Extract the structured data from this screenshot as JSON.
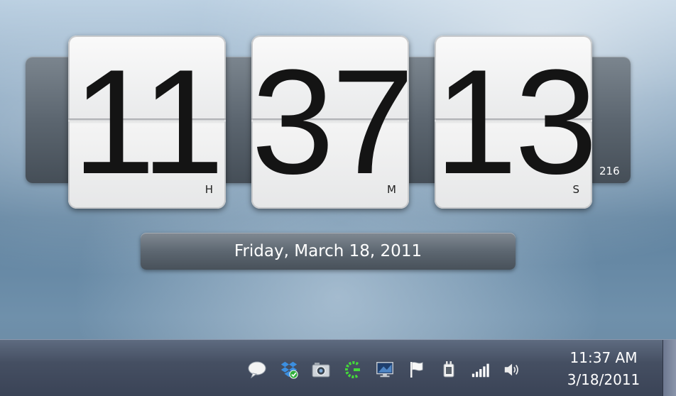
{
  "flip_clock": {
    "hours": "11",
    "minutes": "37",
    "seconds": "13",
    "hours_unit": "H",
    "minutes_unit": "M",
    "seconds_unit": "S",
    "milliseconds": "216",
    "date": "Friday, March 18, 2011"
  },
  "taskbar": {
    "tray_icons": [
      "chat-bubble-icon",
      "dropbox-icon",
      "camera-icon",
      "green-c-icon",
      "display-network-icon",
      "flag-icon",
      "power-plug-icon",
      "signal-bars-icon",
      "speaker-icon"
    ],
    "clock_time": "11:37 AM",
    "clock_date": "3/18/2011"
  },
  "colors": {
    "taskbar": "#454f62",
    "card": "#f0f0f0",
    "digits": "#141414"
  }
}
